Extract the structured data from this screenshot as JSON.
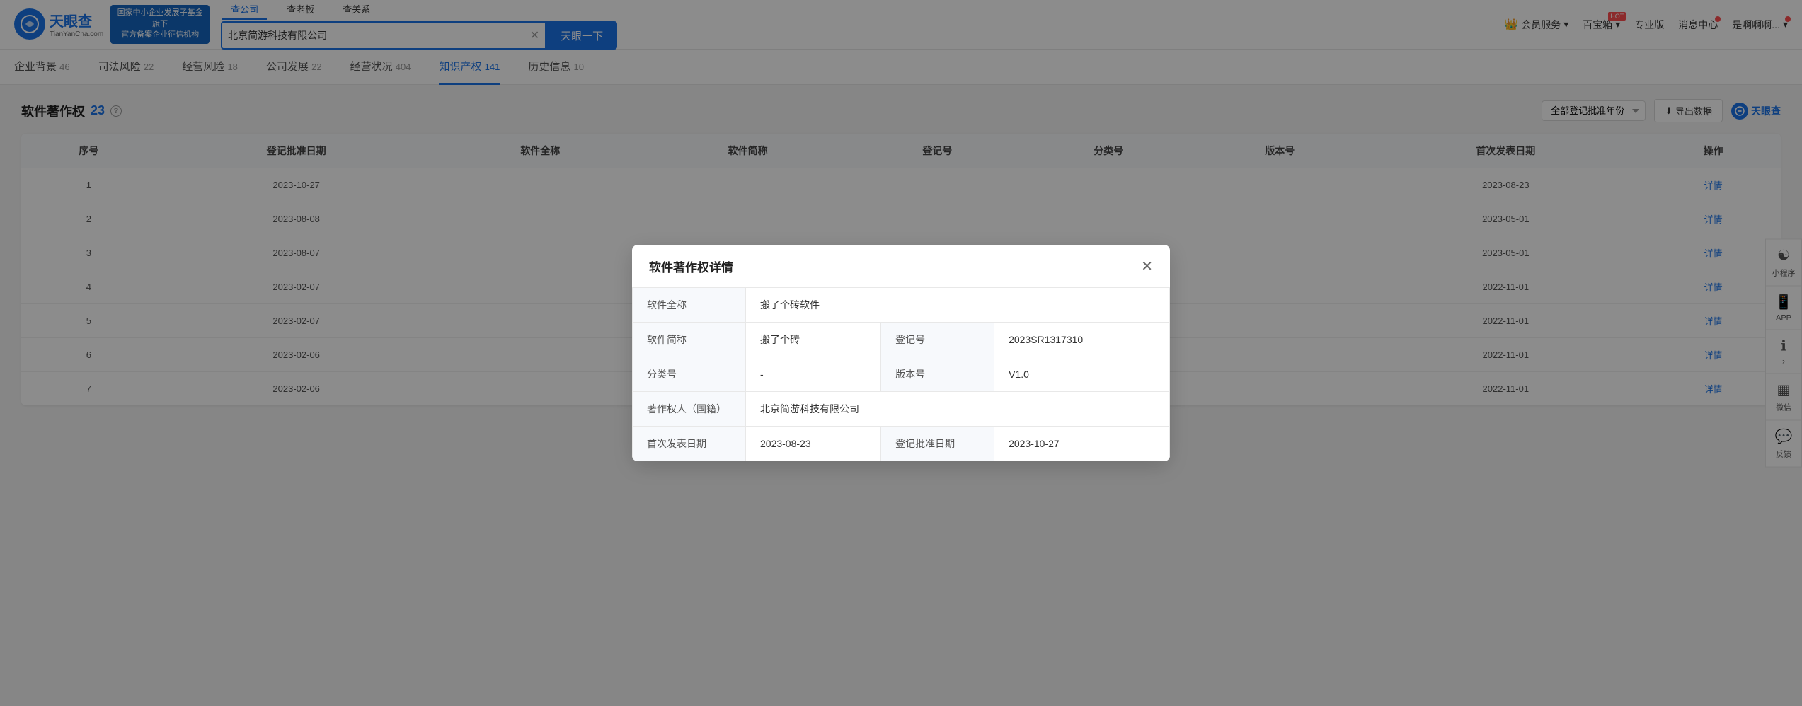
{
  "header": {
    "logo_text_main": "天眼查",
    "logo_text_sub": "TianYanCha.com",
    "gov_badge_line1": "国家中小企业发展子基金旗下",
    "gov_badge_line2": "官方备案企业征信机构",
    "search_tabs": [
      {
        "label": "查公司",
        "active": true
      },
      {
        "label": "查老板",
        "active": false
      },
      {
        "label": "查关系",
        "active": false
      }
    ],
    "search_value": "北京简游科技有限公司",
    "search_btn": "天眼一下",
    "nav_items": [
      {
        "label": "会员服务",
        "icon": "crown"
      },
      {
        "label": "百宝箱",
        "hot": true
      },
      {
        "label": "专业版"
      },
      {
        "label": "消息中心",
        "dot": true
      },
      {
        "label": "是啊啊啊...",
        "dot": true
      }
    ]
  },
  "nav_tabs": [
    {
      "label": "企业背景",
      "count": "46"
    },
    {
      "label": "司法风险",
      "count": "22"
    },
    {
      "label": "经营风险",
      "count": "18"
    },
    {
      "label": "公司发展",
      "count": "22"
    },
    {
      "label": "经营状况",
      "count": "404"
    },
    {
      "label": "知识产权",
      "count": "141",
      "active": true
    },
    {
      "label": "历史信息",
      "count": "10"
    }
  ],
  "section": {
    "title": "软件著作权",
    "count": "23",
    "year_select_label": "全部登记批准年份",
    "export_btn": "导出数据",
    "tyc_logo": "天眼查"
  },
  "table": {
    "columns": [
      "序号",
      "登记批准日期",
      "软件全称",
      "软件简称",
      "登记号",
      "分类号",
      "版本号",
      "首次发表日期",
      "操作"
    ],
    "rows": [
      {
        "index": "1",
        "reg_date": "2023-10-27",
        "full_name": "",
        "short_name": "",
        "reg_no": "",
        "category": "",
        "version": "",
        "pub_date": "2023-08-23",
        "action": "详情"
      },
      {
        "index": "2",
        "reg_date": "2023-08-08",
        "full_name": "",
        "short_name": "",
        "reg_no": "",
        "category": "",
        "version": "",
        "pub_date": "2023-05-01",
        "action": "详情"
      },
      {
        "index": "3",
        "reg_date": "2023-08-07",
        "full_name": "",
        "short_name": "",
        "reg_no": "",
        "category": "",
        "version": "",
        "pub_date": "2023-05-01",
        "action": "详情"
      },
      {
        "index": "4",
        "reg_date": "2023-02-07",
        "full_name": "",
        "short_name": "",
        "reg_no": "",
        "category": "",
        "version": "",
        "pub_date": "2022-11-01",
        "action": "详情"
      },
      {
        "index": "5",
        "reg_date": "2023-02-07",
        "full_name": "",
        "short_name": "",
        "reg_no": "",
        "category": "",
        "version": "",
        "pub_date": "2022-11-01",
        "action": "详情"
      },
      {
        "index": "6",
        "reg_date": "2023-02-06",
        "full_name": "",
        "short_name": "",
        "reg_no": "",
        "category": "",
        "version": "",
        "pub_date": "2022-11-01",
        "action": "详情"
      },
      {
        "index": "7",
        "reg_date": "2023-02-06",
        "full_name": "",
        "short_name": "",
        "reg_no": "",
        "category": "",
        "version": "",
        "pub_date": "2022-11-01",
        "action": "详情"
      }
    ]
  },
  "float_panel": [
    {
      "icon": "☯",
      "label": "小程序"
    },
    {
      "icon": "📱",
      "label": "APP"
    },
    {
      "icon": "ℹ",
      "label": ""
    },
    {
      "icon": "▶",
      "label": ""
    },
    {
      "icon": "▦",
      "label": "微信"
    },
    {
      "icon": "💬",
      "label": "反馈"
    }
  ],
  "modal": {
    "title": "软件著作权详情",
    "fields": [
      {
        "label": "软件全称",
        "value": "搬了个砖软件",
        "colspan": true
      },
      {
        "label": "软件简称",
        "value": "搬了个砖",
        "label2": "登记号",
        "value2": "2023SR1317310"
      },
      {
        "label": "分类号",
        "value": "-",
        "label2": "版本号",
        "value2": "V1.0"
      },
      {
        "label": "著作权人（国籍）",
        "value": "北京简游科技有限公司",
        "colspan": true
      },
      {
        "label": "首次发表日期",
        "value": "2023-08-23",
        "label2": "登记批准日期",
        "value2": "2023-10-27"
      }
    ]
  }
}
